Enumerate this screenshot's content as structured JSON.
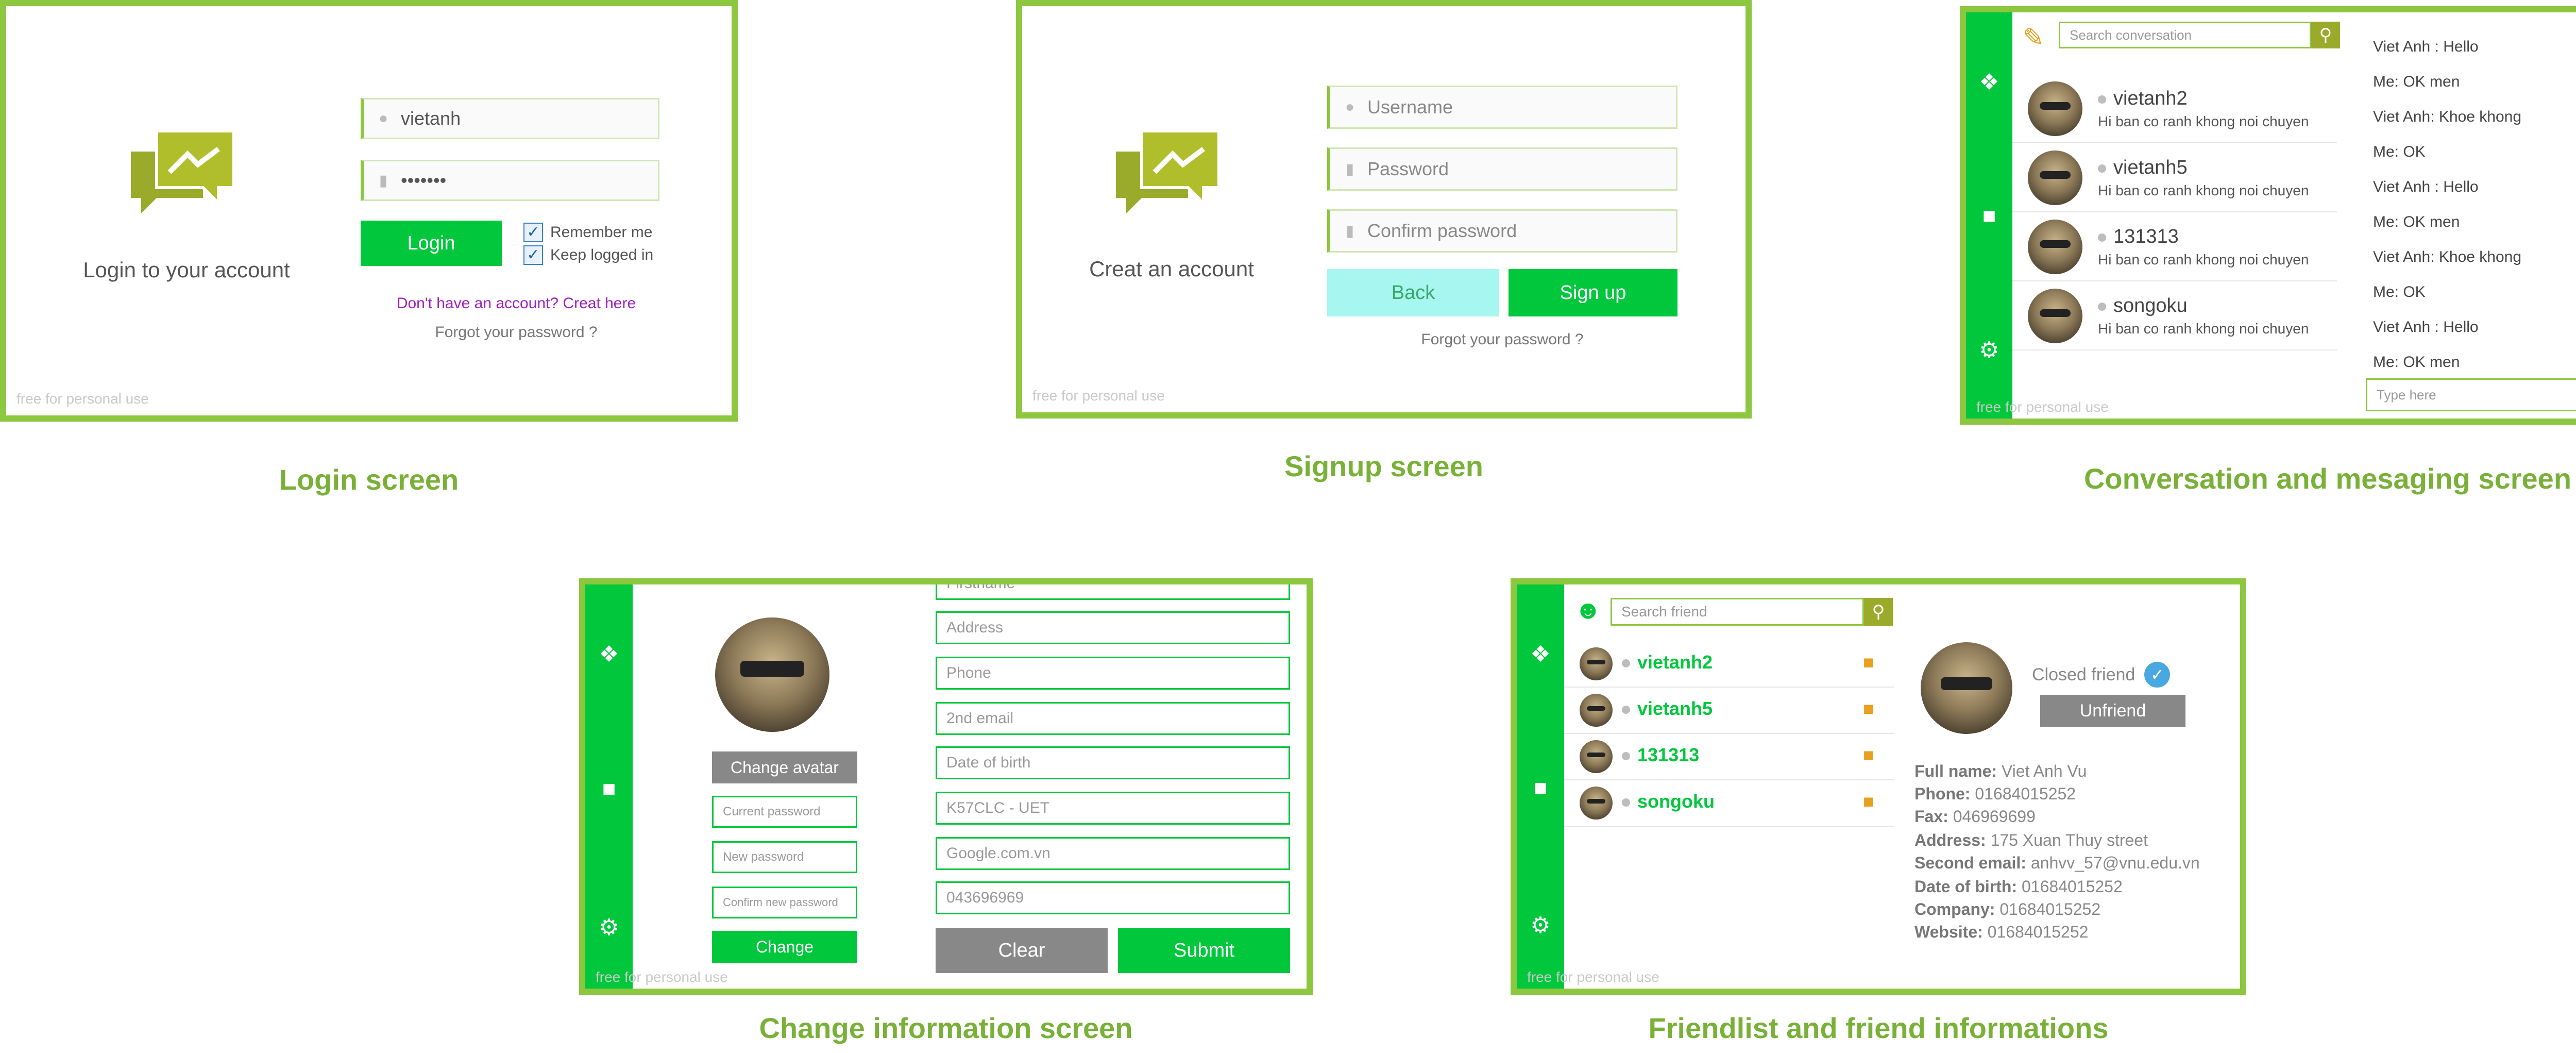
{
  "login": {
    "username_value": "vietanh",
    "password_value": "•••••••",
    "title": "Login to your account",
    "login_label": "Login",
    "remember_label": "Remember me",
    "keep_label": "Keep logged in",
    "no_account": "Don't have an account? Creat here",
    "forgot": "Forgot your password ?",
    "watermark": "free for personal use",
    "caption": "Login screen"
  },
  "signup": {
    "title": "Creat an account",
    "username_placeholder": "Username",
    "password_placeholder": "Password",
    "confirm_placeholder": "Confirm password",
    "back_label": "Back",
    "signup_label": "Sign up",
    "forgot": "Forgot your password ?",
    "watermark": "free for personal use",
    "caption": "Signup screen"
  },
  "conversation": {
    "search_placeholder": "Search conversation",
    "items": [
      {
        "name": "vietanh2",
        "message": "Hi ban co ranh khong noi chuyen"
      },
      {
        "name": "vietanh5",
        "message": "Hi ban co ranh khong noi chuyen"
      },
      {
        "name": "131313",
        "message": "Hi ban co ranh khong noi chuyen"
      },
      {
        "name": "songoku",
        "message": "Hi ban co ranh khong noi chuyen"
      }
    ],
    "messages": [
      "Viet Anh : Hello",
      "Me: OK men",
      "Viet Anh: Khoe khong",
      "Me: OK",
      "Viet Anh : Hello",
      "Me: OK men",
      "Viet Anh: Khoe khong",
      "Me: OK",
      "Viet Anh : Hello",
      "Me: OK men"
    ],
    "type_placeholder": "Type here",
    "watermark": "free for personal use",
    "caption": "Conversation and mesaging screen"
  },
  "change_info": {
    "change_avatar_label": "Change avatar",
    "current_password_placeholder": "Current password",
    "new_password_placeholder": "New password",
    "confirm_new_placeholder": "Confirm new password",
    "change_label": "Change",
    "fields": [
      "Firstname",
      "Address",
      "Phone",
      "2nd email",
      "Date of birth",
      "K57CLC - UET",
      "Google.com.vn",
      "043696969"
    ],
    "clear_label": "Clear",
    "submit_label": "Submit",
    "watermark": "free for personal use",
    "caption": "Change information screen"
  },
  "friendlist": {
    "search_placeholder": "Search friend",
    "friends": [
      "vietanh2",
      "vietanh5",
      "131313",
      "songoku"
    ],
    "closed_friend_label": "Closed friend",
    "unfriend_label": "Unfriend",
    "info": [
      {
        "label": "Full name:",
        "value": "Viet Anh Vu"
      },
      {
        "label": "Phone:",
        "value": "01684015252"
      },
      {
        "label": "Fax:",
        "value": "046969699"
      },
      {
        "label": "Address:",
        "value": "175 Xuan Thuy street"
      },
      {
        "label": "Second email:",
        "value": "anhvv_57@vnu.edu.vn"
      },
      {
        "label": "Date of birth:",
        "value": "01684015252"
      },
      {
        "label": "Company:",
        "value": "01684015252"
      },
      {
        "label": "Website:",
        "value": "01684015252"
      }
    ],
    "watermark": "free for personal use",
    "caption": "Friendlist and friend informations"
  },
  "colors": {
    "frame": "#8dc63f",
    "accent": "#00c73c",
    "logo": "#9aaa2a",
    "orange": "#e8a020",
    "link": "#a020c0"
  }
}
